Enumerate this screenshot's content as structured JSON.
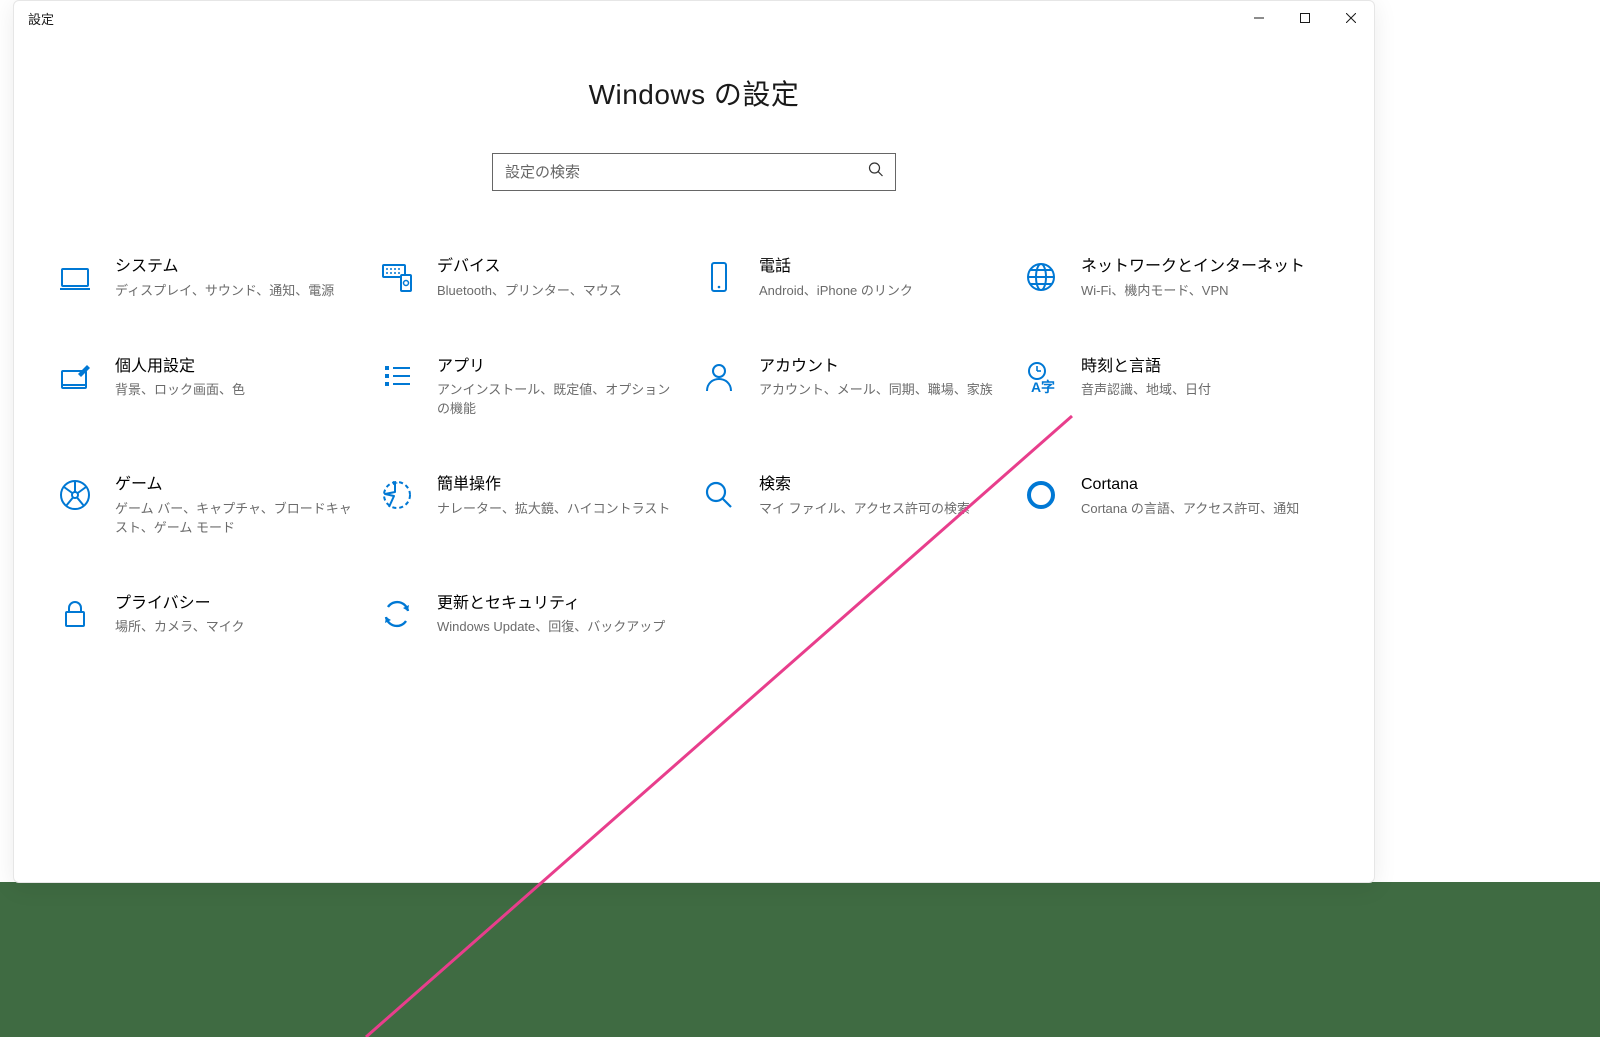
{
  "window": {
    "title": "設定",
    "page_title": "Windows の設定"
  },
  "search": {
    "placeholder": "設定の検索",
    "value": ""
  },
  "colors": {
    "accent": "#0078d4",
    "bottom_bar": "#3f6b42",
    "annotation_line": "#e83e8c"
  },
  "tiles": [
    {
      "icon": "system-icon",
      "title": "システム",
      "desc": "ディスプレイ、サウンド、通知、電源"
    },
    {
      "icon": "devices-icon",
      "title": "デバイス",
      "desc": "Bluetooth、プリンター、マウス"
    },
    {
      "icon": "phone-icon",
      "title": "電話",
      "desc": "Android、iPhone のリンク"
    },
    {
      "icon": "network-icon",
      "title": "ネットワークとインターネット",
      "desc": "Wi-Fi、機内モード、VPN"
    },
    {
      "icon": "personalize-icon",
      "title": "個人用設定",
      "desc": "背景、ロック画面、色"
    },
    {
      "icon": "apps-icon",
      "title": "アプリ",
      "desc": "アンインストール、既定値、オプションの機能"
    },
    {
      "icon": "accounts-icon",
      "title": "アカウント",
      "desc": "アカウント、メール、同期、職場、家族"
    },
    {
      "icon": "time-lang-icon",
      "title": "時刻と言語",
      "desc": "音声認識、地域、日付"
    },
    {
      "icon": "gaming-icon",
      "title": "ゲーム",
      "desc": "ゲーム バー、キャプチャ、ブロードキャスト、ゲーム モード"
    },
    {
      "icon": "ease-icon",
      "title": "簡単操作",
      "desc": "ナレーター、拡大鏡、ハイコントラスト"
    },
    {
      "icon": "search-cat-icon",
      "title": "検索",
      "desc": "マイ ファイル、アクセス許可の検索"
    },
    {
      "icon": "cortana-icon",
      "title": "Cortana",
      "desc": "Cortana の言語、アクセス許可、通知"
    },
    {
      "icon": "privacy-icon",
      "title": "プライバシー",
      "desc": "場所、カメラ、マイク"
    },
    {
      "icon": "update-icon",
      "title": "更新とセキュリティ",
      "desc": "Windows Update、回復、バックアップ"
    }
  ]
}
